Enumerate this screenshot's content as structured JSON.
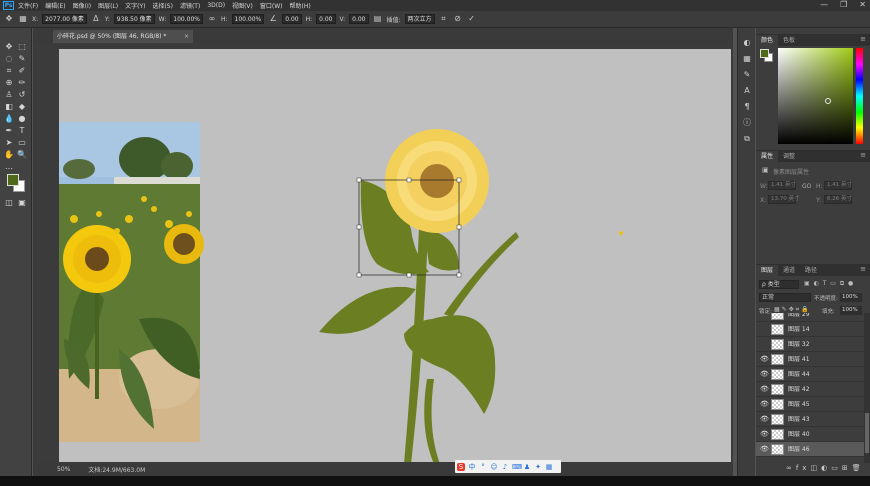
{
  "app": {
    "logo": "Ps",
    "window_controls": [
      "—",
      "❐",
      "✕"
    ]
  },
  "menu": [
    "文件(F)",
    "编辑(E)",
    "图像(I)",
    "图层(L)",
    "文字(Y)",
    "选择(S)",
    "滤镜(T)",
    "3D(D)",
    "视图(V)",
    "窗口(W)",
    "帮助(H)"
  ],
  "options": {
    "x_label": "X:",
    "x_value": "2077.00 像素",
    "y_label": "Y:",
    "y_value": "938.50 像素",
    "w_label": "W:",
    "w_value": "100.00%",
    "h_label": "H:",
    "h_value": "100.00%",
    "angle_value": "0.00",
    "hskew_label": "H:",
    "hskew_value": "0.00",
    "vskew_label": "V:",
    "vskew_value": "0.00",
    "interp_label": "插值:",
    "interp_value": "两次立方"
  },
  "document": {
    "tab_title": "小碎花.psd @ 50% (图层 46, RGB/8) *",
    "close": "×"
  },
  "status": {
    "zoom": "50%",
    "doc_info": "文档:24.9M/663.0M"
  },
  "panels": {
    "color_tabs": [
      "颜色",
      "色板"
    ],
    "properties_tabs": [
      "属性",
      "调整"
    ],
    "properties_title": "像素图层属性",
    "prop_fields": {
      "w_label": "W:",
      "w_value": "1.41 英寸",
      "h_label": "H:",
      "h_value": "1.41 英寸",
      "link": "GO",
      "x_label": "X:",
      "x_value": "13.70 英寸",
      "y_label": "Y:",
      "y_value": "6.26 英寸"
    },
    "layers_tabs": [
      "图层",
      "通道",
      "路径"
    ],
    "layers_filter": "ρ 类型",
    "blend_mode": "正常",
    "opacity_label": "不透明度:",
    "opacity_value": "100%",
    "lock_label": "锁定:",
    "fill_label": "填充:",
    "fill_value": "100%",
    "layers": [
      {
        "name": "图层 29",
        "visible": false,
        "selected": false
      },
      {
        "name": "图层 14",
        "visible": false,
        "selected": false
      },
      {
        "name": "图层 32",
        "visible": false,
        "selected": false
      },
      {
        "name": "图层 41",
        "visible": true,
        "selected": false
      },
      {
        "name": "图层 44",
        "visible": true,
        "selected": false
      },
      {
        "name": "图层 42",
        "visible": true,
        "selected": false
      },
      {
        "name": "图层 45",
        "visible": true,
        "selected": false
      },
      {
        "name": "图层 43",
        "visible": true,
        "selected": false
      },
      {
        "name": "图层 40",
        "visible": true,
        "selected": false
      },
      {
        "name": "图层 46",
        "visible": true,
        "selected": true
      }
    ],
    "layer_footer_icons": [
      "link-icon",
      "fx-icon",
      "mask-icon",
      "adjustment-icon",
      "group-icon",
      "new-layer-icon",
      "delete-icon"
    ]
  },
  "colors": {
    "foreground": "#4e6a19",
    "background": "#ffffff",
    "canvas": "#c0c0c0",
    "petal": "#f2cf57",
    "leaf": "#6b7f22",
    "center": "#a87a2e"
  }
}
